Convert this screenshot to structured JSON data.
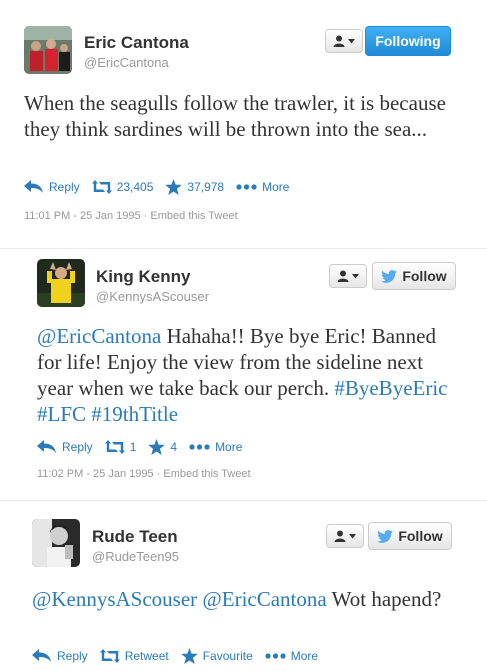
{
  "tweets": [
    {
      "name": "Eric Cantona",
      "handle": "@EricCantona",
      "follow_label": "Following",
      "text_parts": [
        "When the seagulls follow the trawler, it is because they think sardines will be thrown into the sea..."
      ],
      "actions": {
        "reply": "Reply",
        "retweet_count": "23,405",
        "favourite_count": "37,978",
        "more": "More"
      },
      "timestamp": "11:01 PM - 25 Jan 1995",
      "embed": "Embed this Tweet",
      "separator": "·"
    },
    {
      "name": "King Kenny",
      "handle": "@KennysAScouser",
      "follow_label": "Follow",
      "mention": "@EricCantona",
      "text_body": " Hahaha!! Bye bye Eric! Banned for life! Enjoy the view from the sideline next year when we take back our perch. ",
      "hashtags": [
        "#ByeByeEric",
        "#LFC",
        "#19thTitle"
      ],
      "actions": {
        "reply": "Reply",
        "retweet_count": "1",
        "favourite_count": "4",
        "more": "More"
      },
      "timestamp": "11:02 PM - 25 Jan 1995",
      "embed": "Embed this Tweet",
      "separator": "·"
    },
    {
      "name": "Rude Teen",
      "handle": "@RudeTeen95",
      "follow_label": "Follow",
      "mentions": [
        "@KennysAScouser",
        "@EricCantona"
      ],
      "text_body": " Wot hapend?",
      "actions": {
        "reply": "Reply",
        "retweet": "Retweet",
        "favourite": "Favourite",
        "more": "More"
      }
    }
  ],
  "colors": {
    "link": "#2b7bb9",
    "following_bg": "#2a9ae6",
    "twitter_bird": "#55acee"
  },
  "icons": [
    "user-icon",
    "caret-down-icon",
    "twitter-bird-icon",
    "reply-icon",
    "retweet-icon",
    "star-icon",
    "more-dots-icon"
  ]
}
